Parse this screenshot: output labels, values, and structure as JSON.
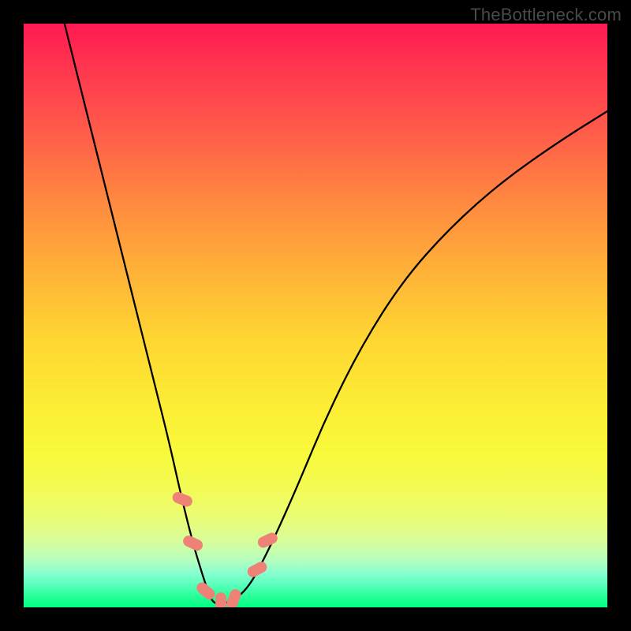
{
  "watermark": "TheBottleneck.com",
  "chart_data": {
    "type": "line",
    "title": "",
    "xlabel": "",
    "ylabel": "",
    "xlim": [
      0,
      100
    ],
    "ylim": [
      0,
      100
    ],
    "grid": false,
    "legend": false,
    "series": [
      {
        "name": "curve",
        "color": "#000000",
        "x": [
          7,
          10,
          13,
          16,
          19,
          22,
          25,
          27,
          29,
          30.5,
          31.5,
          32.2,
          33.0,
          34.0,
          35.5,
          37,
          38.5,
          40,
          43,
          47,
          52,
          58,
          65,
          73,
          82,
          92,
          100
        ],
        "y": [
          100,
          88,
          76,
          64,
          52,
          40,
          28,
          19,
          11,
          6,
          3,
          1.2,
          0.6,
          0.6,
          1.0,
          2.0,
          3.6,
          6,
          12,
          21,
          33,
          45,
          56,
          65,
          73,
          80,
          85
        ]
      }
    ],
    "markers": [
      {
        "name": "marker-a",
        "color": "#ef8277",
        "x": 27.2,
        "y": 18.5,
        "rotation": -68
      },
      {
        "name": "marker-b",
        "color": "#ef8277",
        "x": 29.0,
        "y": 11.0,
        "rotation": -65
      },
      {
        "name": "marker-c",
        "color": "#ef8277",
        "x": 31.2,
        "y": 2.8,
        "rotation": -50
      },
      {
        "name": "marker-d",
        "color": "#ef8277",
        "x": 33.8,
        "y": 0.8,
        "rotation": 0
      },
      {
        "name": "marker-e",
        "color": "#ef8277",
        "x": 36.0,
        "y": 1.4,
        "rotation": 20
      },
      {
        "name": "marker-f",
        "color": "#ef8277",
        "x": 40.0,
        "y": 6.5,
        "rotation": 62
      },
      {
        "name": "marker-g",
        "color": "#ef8277",
        "x": 41.8,
        "y": 11.5,
        "rotation": 65
      }
    ],
    "gradient_stops": [
      {
        "pos": 0,
        "color": "#ff1a52"
      },
      {
        "pos": 50,
        "color": "#ffd030"
      },
      {
        "pos": 80,
        "color": "#f0fa50"
      },
      {
        "pos": 100,
        "color": "#00ff7e"
      }
    ]
  }
}
